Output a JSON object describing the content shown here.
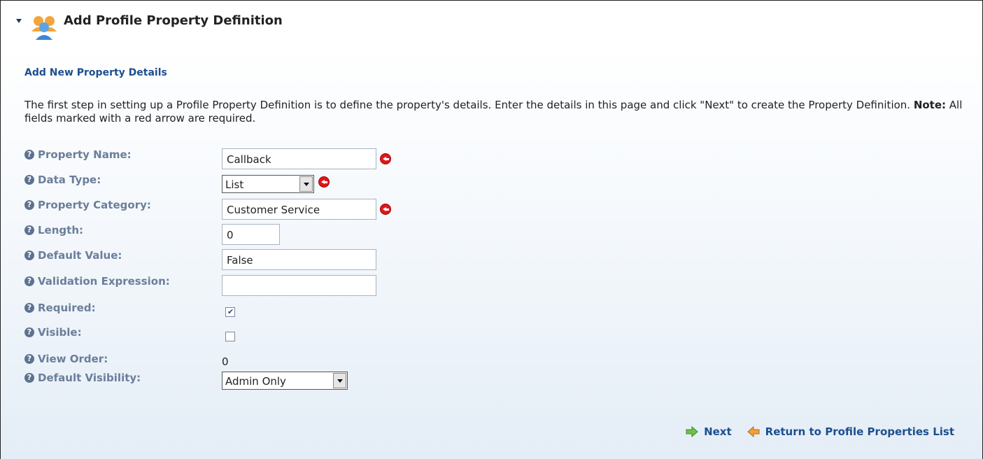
{
  "header": {
    "title": "Add Profile Property Definition",
    "icon": "users-icon"
  },
  "section": {
    "title": "Add New Property Details",
    "intro_text": "The first step in setting up a Profile Property Definition is to define the property's details. Enter the details in this page and click \"Next\" to create the Property Definition. ",
    "note_label": "Note:",
    "note_text": " All fields marked with a red arrow are required."
  },
  "form": {
    "property_name": {
      "label": "Property Name:",
      "value": "Callback",
      "required": true
    },
    "data_type": {
      "label": "Data Type:",
      "selected": "List",
      "required": true
    },
    "property_category": {
      "label": "Property Category:",
      "value": "Customer Service",
      "required": true
    },
    "length": {
      "label": "Length:",
      "value": "0"
    },
    "default_value": {
      "label": "Default Value:",
      "value": "False"
    },
    "validation_expression": {
      "label": "Validation Expression:",
      "value": ""
    },
    "required": {
      "label": "Required:",
      "checked": true
    },
    "visible": {
      "label": "Visible:",
      "checked": false
    },
    "view_order": {
      "label": "View Order:",
      "value": "0"
    },
    "default_visibility": {
      "label": "Default Visibility:",
      "selected": "Admin Only"
    }
  },
  "actions": {
    "next_label": "Next",
    "return_label": "Return to Profile Properties List"
  },
  "colors": {
    "label": "#6b7e9a",
    "section_title": "#1d4f8f",
    "required_marker": "#e0161b"
  }
}
